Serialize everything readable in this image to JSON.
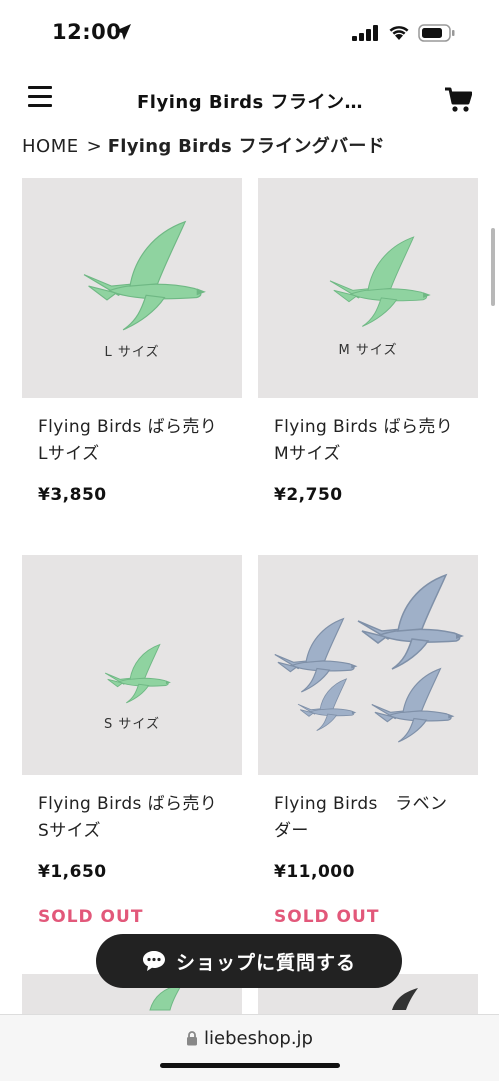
{
  "status": {
    "time": "12:00"
  },
  "header": {
    "title": "Flying Birds フライン…"
  },
  "breadcrumb": {
    "home": "HOME",
    "separator": ">",
    "current": "Flying Birds フライングバード"
  },
  "products": [
    {
      "name": "Flying Birds ばら売り Lサイズ",
      "price": "¥3,850",
      "image_label": "L サイズ",
      "image_icon": "green-bird-icon"
    },
    {
      "name": "Flying Birds ばら売り Mサイズ",
      "price": "¥2,750",
      "image_label": "M サイズ",
      "image_icon": "green-bird-icon"
    },
    {
      "name": "Flying Birds ばら売り Sサイズ",
      "price": "¥1,650",
      "image_label": "S サイズ",
      "status": "SOLD OUT",
      "image_icon": "green-bird-icon"
    },
    {
      "name": "Flying Birds　ラベンダー",
      "price": "¥11,000",
      "status": "SOLD OUT",
      "image_icon": "lavender-birds-icon"
    }
  ],
  "chat_button": {
    "label": "ショップに質問する",
    "icon": "chat-bubble-icon"
  },
  "browser": {
    "url": "liebeshop.jp"
  },
  "colors": {
    "sold_out": "#e2587a",
    "bird_green": "#8fd3a0",
    "bird_lavender": "#9fb0c8",
    "card_bg": "#e6e4e4",
    "button_bg": "#222222"
  }
}
